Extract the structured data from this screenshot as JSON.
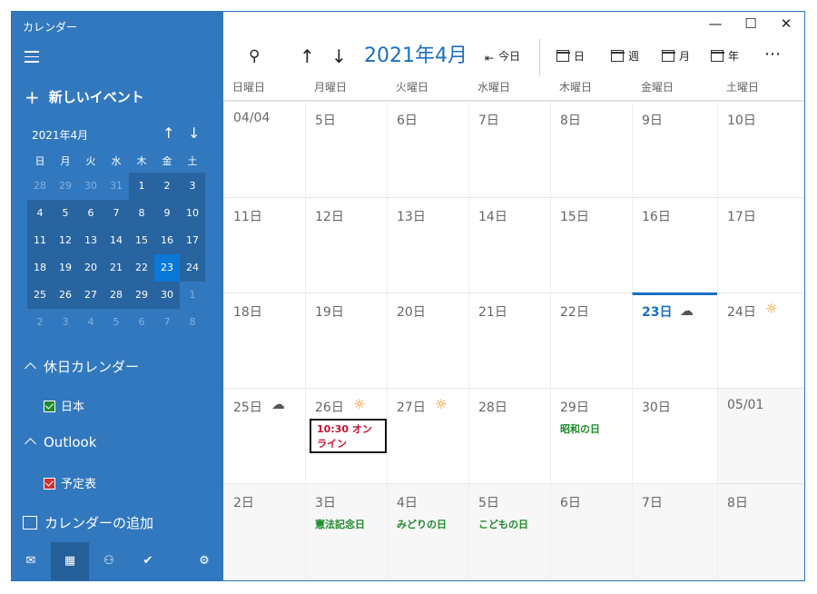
{
  "app": {
    "title": "カレンダー"
  },
  "window_controls": {
    "minimize": "—",
    "maximize": "☐",
    "close": "✕"
  },
  "sidebar": {
    "new_event": "新しいイベント",
    "mini_calendar": {
      "month_label": "2021年4月",
      "weekdays": [
        "日",
        "月",
        "火",
        "水",
        "木",
        "金",
        "土"
      ],
      "days": [
        {
          "d": "28",
          "cur": false
        },
        {
          "d": "29",
          "cur": false
        },
        {
          "d": "30",
          "cur": false
        },
        {
          "d": "31",
          "cur": false
        },
        {
          "d": "1",
          "cur": true
        },
        {
          "d": "2",
          "cur": true
        },
        {
          "d": "3",
          "cur": true
        },
        {
          "d": "4",
          "cur": true
        },
        {
          "d": "5",
          "cur": true
        },
        {
          "d": "6",
          "cur": true
        },
        {
          "d": "7",
          "cur": true
        },
        {
          "d": "8",
          "cur": true
        },
        {
          "d": "9",
          "cur": true
        },
        {
          "d": "10",
          "cur": true
        },
        {
          "d": "11",
          "cur": true
        },
        {
          "d": "12",
          "cur": true
        },
        {
          "d": "13",
          "cur": true
        },
        {
          "d": "14",
          "cur": true
        },
        {
          "d": "15",
          "cur": true
        },
        {
          "d": "16",
          "cur": true
        },
        {
          "d": "17",
          "cur": true
        },
        {
          "d": "18",
          "cur": true
        },
        {
          "d": "19",
          "cur": true
        },
        {
          "d": "20",
          "cur": true
        },
        {
          "d": "21",
          "cur": true
        },
        {
          "d": "22",
          "cur": true
        },
        {
          "d": "23",
          "cur": true,
          "today": true
        },
        {
          "d": "24",
          "cur": true
        },
        {
          "d": "25",
          "cur": true
        },
        {
          "d": "26",
          "cur": true
        },
        {
          "d": "27",
          "cur": true
        },
        {
          "d": "28",
          "cur": true
        },
        {
          "d": "29",
          "cur": true
        },
        {
          "d": "30",
          "cur": true
        },
        {
          "d": "1",
          "cur": false
        },
        {
          "d": "2",
          "cur": false
        },
        {
          "d": "3",
          "cur": false
        },
        {
          "d": "4",
          "cur": false
        },
        {
          "d": "5",
          "cur": false
        },
        {
          "d": "6",
          "cur": false
        },
        {
          "d": "7",
          "cur": false
        },
        {
          "d": "8",
          "cur": false
        }
      ]
    },
    "holiday_section": "休日カレンダー",
    "holiday_calendar": "日本",
    "holiday_calendar_color": "#1d8a2c",
    "outlook_section": "Outlook",
    "outlook_calendar": "予定表",
    "outlook_calendar_color": "#d32f2f",
    "add_calendar": "カレンダーの追加"
  },
  "toolbar": {
    "month_title": "2021年4月",
    "today": "今日",
    "day": "日",
    "week": "週",
    "month": "月",
    "year": "年"
  },
  "weekday_headers": [
    "日曜日",
    "月曜日",
    "火曜日",
    "水曜日",
    "木曜日",
    "金曜日",
    "土曜日"
  ],
  "weeks": [
    [
      {
        "label": "04/04"
      },
      {
        "label": "5日"
      },
      {
        "label": "6日"
      },
      {
        "label": "7日"
      },
      {
        "label": "8日"
      },
      {
        "label": "9日"
      },
      {
        "label": "10日"
      }
    ],
    [
      {
        "label": "11日"
      },
      {
        "label": "12日"
      },
      {
        "label": "13日"
      },
      {
        "label": "14日"
      },
      {
        "label": "15日"
      },
      {
        "label": "16日"
      },
      {
        "label": "17日"
      }
    ],
    [
      {
        "label": "18日"
      },
      {
        "label": "19日"
      },
      {
        "label": "20日"
      },
      {
        "label": "21日"
      },
      {
        "label": "22日"
      },
      {
        "label": "23日",
        "today": true,
        "weather": "cloud"
      },
      {
        "label": "24日",
        "weather": "sun"
      }
    ],
    [
      {
        "label": "25日",
        "weather": "cloud"
      },
      {
        "label": "26日",
        "weather": "sun",
        "event": "10:30 オンライン"
      },
      {
        "label": "27日",
        "weather": "sun"
      },
      {
        "label": "28日"
      },
      {
        "label": "29日",
        "holiday": "昭和の日"
      },
      {
        "label": "30日"
      },
      {
        "label": "05/01",
        "other": true
      }
    ],
    [
      {
        "label": "2日",
        "other": true
      },
      {
        "label": "3日",
        "other": true,
        "holiday": "憲法記念日"
      },
      {
        "label": "4日",
        "other": true,
        "holiday": "みどりの日"
      },
      {
        "label": "5日",
        "other": true,
        "holiday": "こどもの日"
      },
      {
        "label": "6日",
        "other": true
      },
      {
        "label": "7日",
        "other": true
      },
      {
        "label": "8日",
        "other": true
      }
    ]
  ]
}
